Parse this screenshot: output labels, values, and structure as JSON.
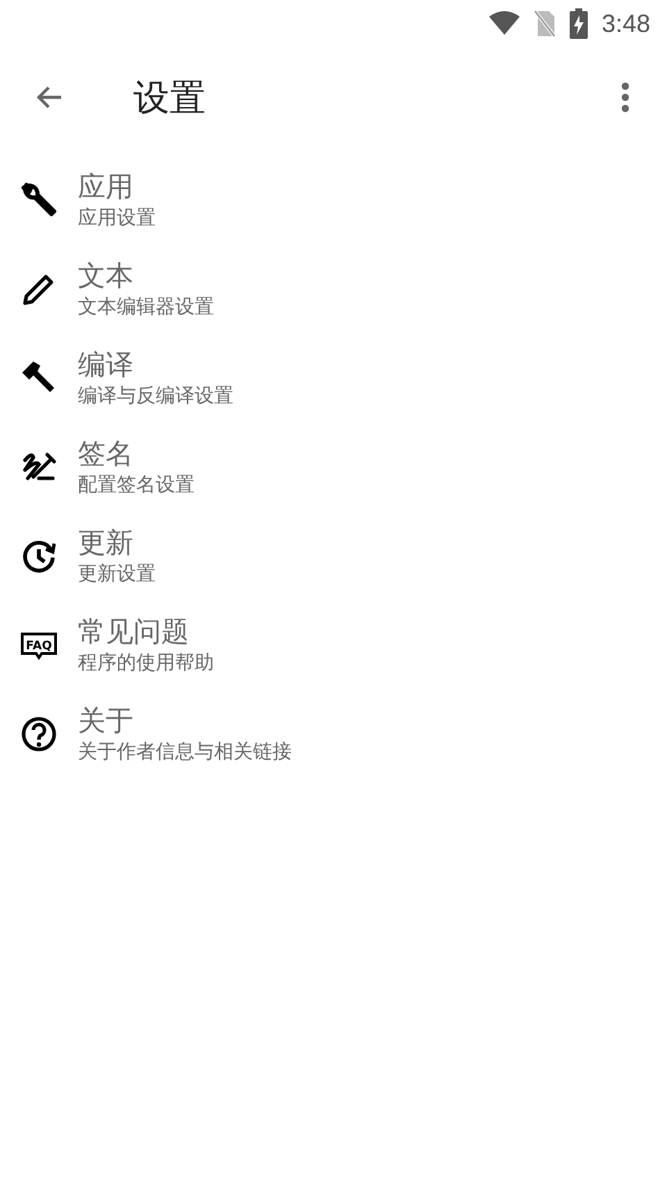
{
  "status_bar": {
    "time": "3:48"
  },
  "toolbar": {
    "title": "设置"
  },
  "items": [
    {
      "title": "应用",
      "subtitle": "应用设置"
    },
    {
      "title": "文本",
      "subtitle": "文本编辑器设置"
    },
    {
      "title": "编译",
      "subtitle": "编译与反编译设置"
    },
    {
      "title": "签名",
      "subtitle": "配置签名设置"
    },
    {
      "title": "更新",
      "subtitle": "更新设置"
    },
    {
      "icon_label": "FAQ",
      "title": "常见问题",
      "subtitle": "程序的使用帮助"
    },
    {
      "title": "关于",
      "subtitle": "关于作者信息与相关链接"
    }
  ]
}
